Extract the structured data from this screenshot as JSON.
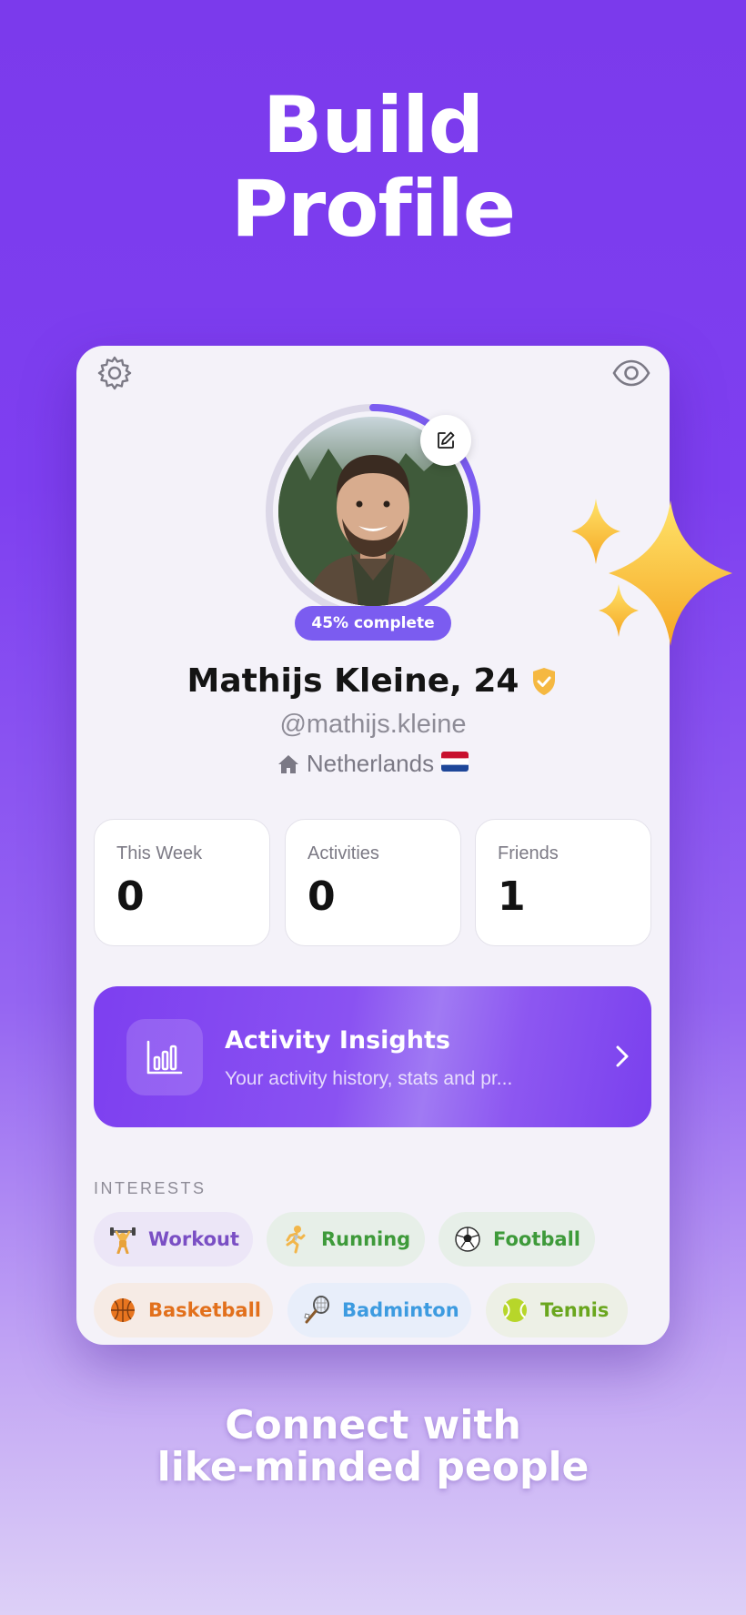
{
  "headline": {
    "line1": "Build",
    "line2": "Profile"
  },
  "profile": {
    "completion_label": "45% complete",
    "completion_percent": 45,
    "name": "Mathijs Kleine, 24",
    "handle": "@mathijs.kleine",
    "location": "Netherlands",
    "flag": "🇳🇱"
  },
  "stats": [
    {
      "label": "This Week",
      "value": "0"
    },
    {
      "label": "Activities",
      "value": "0"
    },
    {
      "label": "Friends",
      "value": "1"
    }
  ],
  "insights": {
    "title": "Activity Insights",
    "subtitle": "Your activity history, stats and pr..."
  },
  "interests": {
    "label": "INTERESTS",
    "items": [
      {
        "label": "Workout",
        "icon": "weightlifter-icon",
        "color": "#7a4fc4",
        "bg": "#ece6f7"
      },
      {
        "label": "Running",
        "icon": "runner-icon",
        "color": "#3e9a3a",
        "bg": "#e7efe8"
      },
      {
        "label": "Football",
        "icon": "soccer-ball-icon",
        "color": "#3e9a3a",
        "bg": "#e7efe8"
      },
      {
        "label": "Basketball",
        "icon": "basketball-icon",
        "color": "#e2701c",
        "bg": "#f6ebe5"
      },
      {
        "label": "Badminton",
        "icon": "badminton-icon",
        "color": "#3d9be0",
        "bg": "#e8eefa"
      },
      {
        "label": "Tennis",
        "icon": "tennis-ball-icon",
        "color": "#6aa61e",
        "bg": "#edf0e6"
      }
    ]
  },
  "tagline": {
    "line1": "Connect with",
    "line2": "like-minded people"
  },
  "colors": {
    "brand": "#7b3aec",
    "pill": "#7b5cf0",
    "verified": "#f5b841"
  }
}
